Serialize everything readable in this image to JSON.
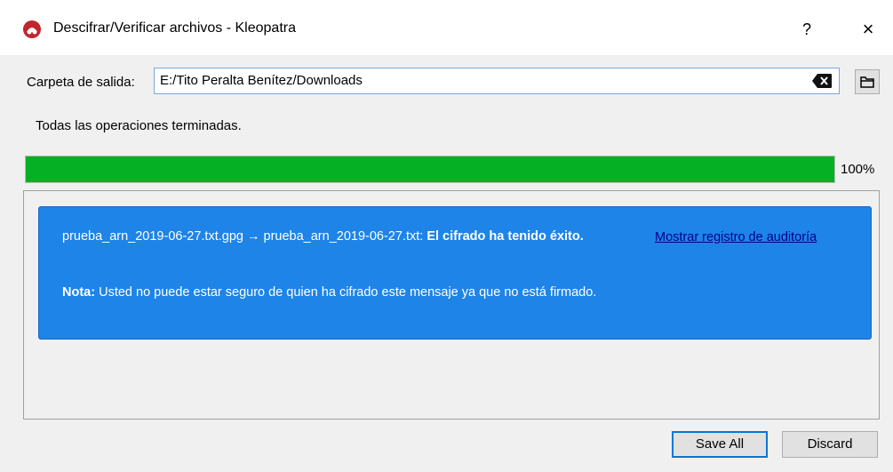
{
  "window": {
    "title": "Descifrar/Verificar archivos - Kleopatra",
    "help_label": "?",
    "close_label": "×",
    "app_icon": "kleopatra-icon"
  },
  "output": {
    "label": "Carpeta de salida:",
    "path": "E:/Tito Peralta Benítez/Downloads",
    "clear_icon": "backspace-icon",
    "browse_icon": "folder-icon"
  },
  "status": {
    "text": "Todas las operaciones terminadas.",
    "progress_percent": 100,
    "progress_label": "100%",
    "progress_color": "#06b025"
  },
  "result": {
    "card_color": "#1e84e8",
    "files": "prueba_arn_2019-06-27.txt.gpg → prueba_arn_2019-06-27.txt:",
    "success": "El cifrado ha tenido éxito.",
    "note_label": "Nota:",
    "note_text": "Usted no puede estar seguro de quien ha cifrado este mensaje ya que no está firmado.",
    "audit_link": "Mostrar registro de auditoría"
  },
  "buttons": {
    "save_all": "Save All",
    "discard": "Discard"
  }
}
